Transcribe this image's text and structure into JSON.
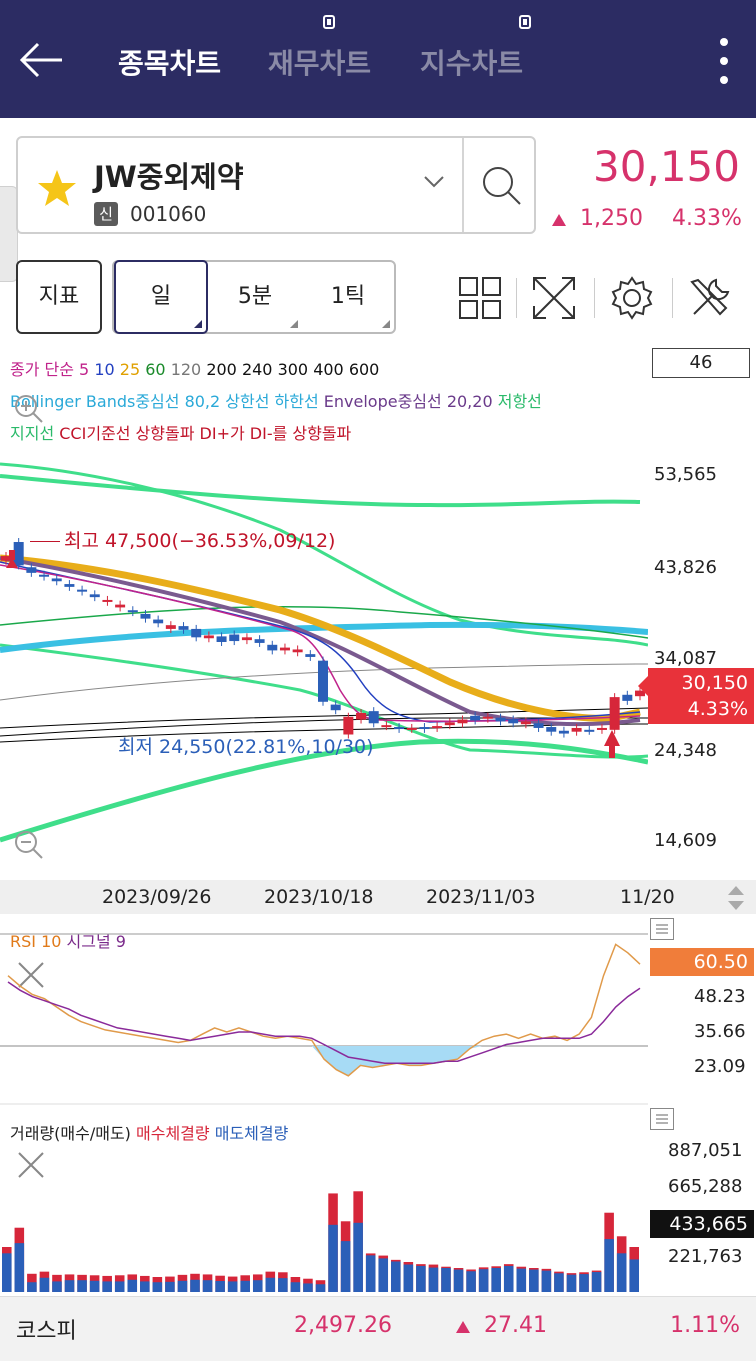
{
  "header": {
    "tabs": [
      {
        "label": "종목차트",
        "active": true
      },
      {
        "label": "재무차트",
        "active": false
      },
      {
        "label": "지수차트",
        "active": false
      }
    ],
    "icons": [
      "back-arrow-icon",
      "more-vertical-icon"
    ]
  },
  "stock": {
    "name": "JW중외제약",
    "badge": "신",
    "code": "001060",
    "price": "30,150",
    "change": "1,250",
    "change_pct": "4.33%",
    "color_up": "#d6326b"
  },
  "toolbar": {
    "indicator_label": "지표",
    "periods": [
      {
        "label": "일",
        "selected": true
      },
      {
        "label": "5분",
        "selected": false
      },
      {
        "label": "1틱",
        "selected": false
      }
    ],
    "icons": [
      "grid-layout-icon",
      "fullscreen-icon",
      "settings-gear-icon",
      "tools-icon"
    ]
  },
  "legend": {
    "line1": [
      {
        "text": "종가 단순 5 ",
        "color": "#c0238b"
      },
      {
        "text": "10 ",
        "color": "#2340c0"
      },
      {
        "text": "25 ",
        "color": "#e0a000"
      },
      {
        "text": "60 ",
        "color": "#1a8a2a"
      },
      {
        "text": "120 ",
        "color": "#777777"
      },
      {
        "text": "200 240 300 400 600",
        "color": "#111111"
      }
    ],
    "line2": [
      {
        "text": "Bollinger Bands중심선 80,2 상한선 하한선 ",
        "color": "#2aa9d8"
      },
      {
        "text": "Envelope중심선 20,20 ",
        "color": "#6a3a8a"
      },
      {
        "text": "저항선",
        "color": "#2aba6a"
      }
    ],
    "line3": [
      {
        "text": "지지선 ",
        "color": "#2aba6a"
      },
      {
        "text": "CCI기준선 상향돌파 DI+가 DI-를 상향돌파",
        "color": "#c0142a"
      }
    ],
    "count": "46"
  },
  "price_axis": {
    "labels": [
      "53,565",
      "43,826",
      "34,087",
      "24,348",
      "14,609"
    ],
    "current_price": "30,150",
    "current_pct": "4.33%"
  },
  "annotations": {
    "high": "최고 47,500(−36.53%,09/12)",
    "low": "최저 24,550(22.81%,10/30)"
  },
  "dates": [
    "2023/09/26",
    "2023/10/18",
    "2023/11/03",
    "11/20"
  ],
  "rsi": {
    "title_a": "RSI 10 ",
    "title_b": "시그널 9",
    "labels": [
      "48.23",
      "35.66",
      "23.09"
    ],
    "current": "60.50"
  },
  "volume": {
    "title_a": "거래량(매수/매도) ",
    "title_b": "매수체결량 ",
    "title_c": "매도체결량",
    "labels": [
      "887,051",
      "665,288",
      "221,763"
    ],
    "current": "433,665"
  },
  "chart_data": {
    "type": "candlestick",
    "note_series": [
      "price",
      "rsi",
      "volume"
    ],
    "y_axis_ticks": [
      53565,
      43826,
      34087,
      24348,
      14609
    ],
    "candles": [
      {
        "o": 44500,
        "c": 45000,
        "up": true
      },
      {
        "o": 46500,
        "c": 44000,
        "up": false
      },
      {
        "o": 43800,
        "c": 43200,
        "up": false
      },
      {
        "o": 43000,
        "c": 42800,
        "up": false
      },
      {
        "o": 42600,
        "c": 42300,
        "up": false
      },
      {
        "o": 42000,
        "c": 41700,
        "up": false
      },
      {
        "o": 41400,
        "c": 41200,
        "up": false
      },
      {
        "o": 40900,
        "c": 40600,
        "up": false
      },
      {
        "o": 40300,
        "c": 40100,
        "up": true
      },
      {
        "o": 39800,
        "c": 39500,
        "up": true
      },
      {
        "o": 39200,
        "c": 39000,
        "up": false
      },
      {
        "o": 38800,
        "c": 38300,
        "up": false
      },
      {
        "o": 38200,
        "c": 37800,
        "up": false
      },
      {
        "o": 37600,
        "c": 37200,
        "up": true
      },
      {
        "o": 37500,
        "c": 37100,
        "up": false
      },
      {
        "o": 37200,
        "c": 36300,
        "up": false
      },
      {
        "o": 36500,
        "c": 36200,
        "up": true
      },
      {
        "o": 36400,
        "c": 35800,
        "up": false
      },
      {
        "o": 36600,
        "c": 35900,
        "up": false
      },
      {
        "o": 36300,
        "c": 36000,
        "up": true
      },
      {
        "o": 36100,
        "c": 35700,
        "up": false
      },
      {
        "o": 35500,
        "c": 34900,
        "up": false
      },
      {
        "o": 35200,
        "c": 34900,
        "up": true
      },
      {
        "o": 35000,
        "c": 34700,
        "up": true
      },
      {
        "o": 34500,
        "c": 34200,
        "up": false
      },
      {
        "o": 33800,
        "c": 29400,
        "up": false
      },
      {
        "o": 29100,
        "c": 28500,
        "up": false
      },
      {
        "o": 25900,
        "c": 27800,
        "up": true
      },
      {
        "o": 27500,
        "c": 28200,
        "up": true
      },
      {
        "o": 28400,
        "c": 27100,
        "up": false
      },
      {
        "o": 26900,
        "c": 26800,
        "up": true
      },
      {
        "o": 26700,
        "c": 26500,
        "up": false
      },
      {
        "o": 26600,
        "c": 26500,
        "up": true
      },
      {
        "o": 26700,
        "c": 26500,
        "up": false
      },
      {
        "o": 26800,
        "c": 26600,
        "up": true
      },
      {
        "o": 27200,
        "c": 26900,
        "up": true
      },
      {
        "o": 27500,
        "c": 27100,
        "up": true
      },
      {
        "o": 27900,
        "c": 27400,
        "up": false
      },
      {
        "o": 27800,
        "c": 27600,
        "up": true
      },
      {
        "o": 27700,
        "c": 27300,
        "up": false
      },
      {
        "o": 27500,
        "c": 27100,
        "up": false
      },
      {
        "o": 27300,
        "c": 27000,
        "up": true
      },
      {
        "o": 27100,
        "c": 26600,
        "up": false
      },
      {
        "o": 26700,
        "c": 26200,
        "up": false
      },
      {
        "o": 26300,
        "c": 26000,
        "up": false
      },
      {
        "o": 26200,
        "c": 26600,
        "up": true
      },
      {
        "o": 26400,
        "c": 26300,
        "up": false
      },
      {
        "o": 26600,
        "c": 26400,
        "up": true
      },
      {
        "o": 26400,
        "c": 29900,
        "up": true
      },
      {
        "o": 29500,
        "c": 30150,
        "up": false
      },
      {
        "o": 30000,
        "c": 30600,
        "up": true
      }
    ],
    "volume_buy": [
      190,
      240,
      48,
      70,
      52,
      58,
      58,
      55,
      52,
      52,
      60,
      52,
      48,
      50,
      55,
      60,
      58,
      54,
      52,
      55,
      58,
      70,
      68,
      48,
      42,
      38,
      460,
      330,
      470,
      180,
      170,
      150,
      140,
      130,
      128,
      118,
      112,
      105,
      115,
      120,
      130,
      118,
      112,
      108,
      95,
      88,
      92,
      100,
      370,
      260,
      210
    ],
    "volume_sell": [
      210,
      300,
      85,
      95,
      80,
      82,
      80,
      78,
      75,
      78,
      82,
      75,
      70,
      72,
      80,
      85,
      82,
      76,
      72,
      78,
      82,
      95,
      92,
      70,
      62,
      55,
      330,
      250,
      340,
      180,
      165,
      150,
      135,
      128,
      120,
      118,
      110,
      102,
      112,
      118,
      128,
      115,
      110,
      105,
      92,
      85,
      88,
      98,
      260,
      190,
      160
    ],
    "rsi_values": [
      55,
      50,
      46,
      44,
      40,
      36,
      33,
      31,
      29,
      28,
      27,
      26,
      25,
      24,
      23,
      24,
      27,
      30,
      28,
      30,
      28,
      26,
      25,
      26,
      25,
      24,
      15,
      10,
      7,
      12,
      11,
      12,
      13,
      12,
      12,
      13,
      14,
      15,
      20,
      24,
      26,
      27,
      25,
      27,
      25,
      26,
      24,
      27,
      35,
      55,
      70,
      66,
      60.5
    ],
    "rsi_signal": [
      52,
      48,
      45,
      43,
      41,
      39,
      36,
      34,
      32,
      30,
      29,
      28,
      27,
      26,
      25,
      24,
      25,
      26,
      27,
      28,
      28,
      27,
      26,
      26,
      26,
      25,
      22,
      19,
      16,
      15,
      14,
      13,
      13,
      13,
      13,
      13,
      14,
      14,
      16,
      18,
      20,
      22,
      23,
      24,
      25,
      25,
      25,
      25,
      27,
      33,
      40,
      45,
      49
    ]
  }
}
